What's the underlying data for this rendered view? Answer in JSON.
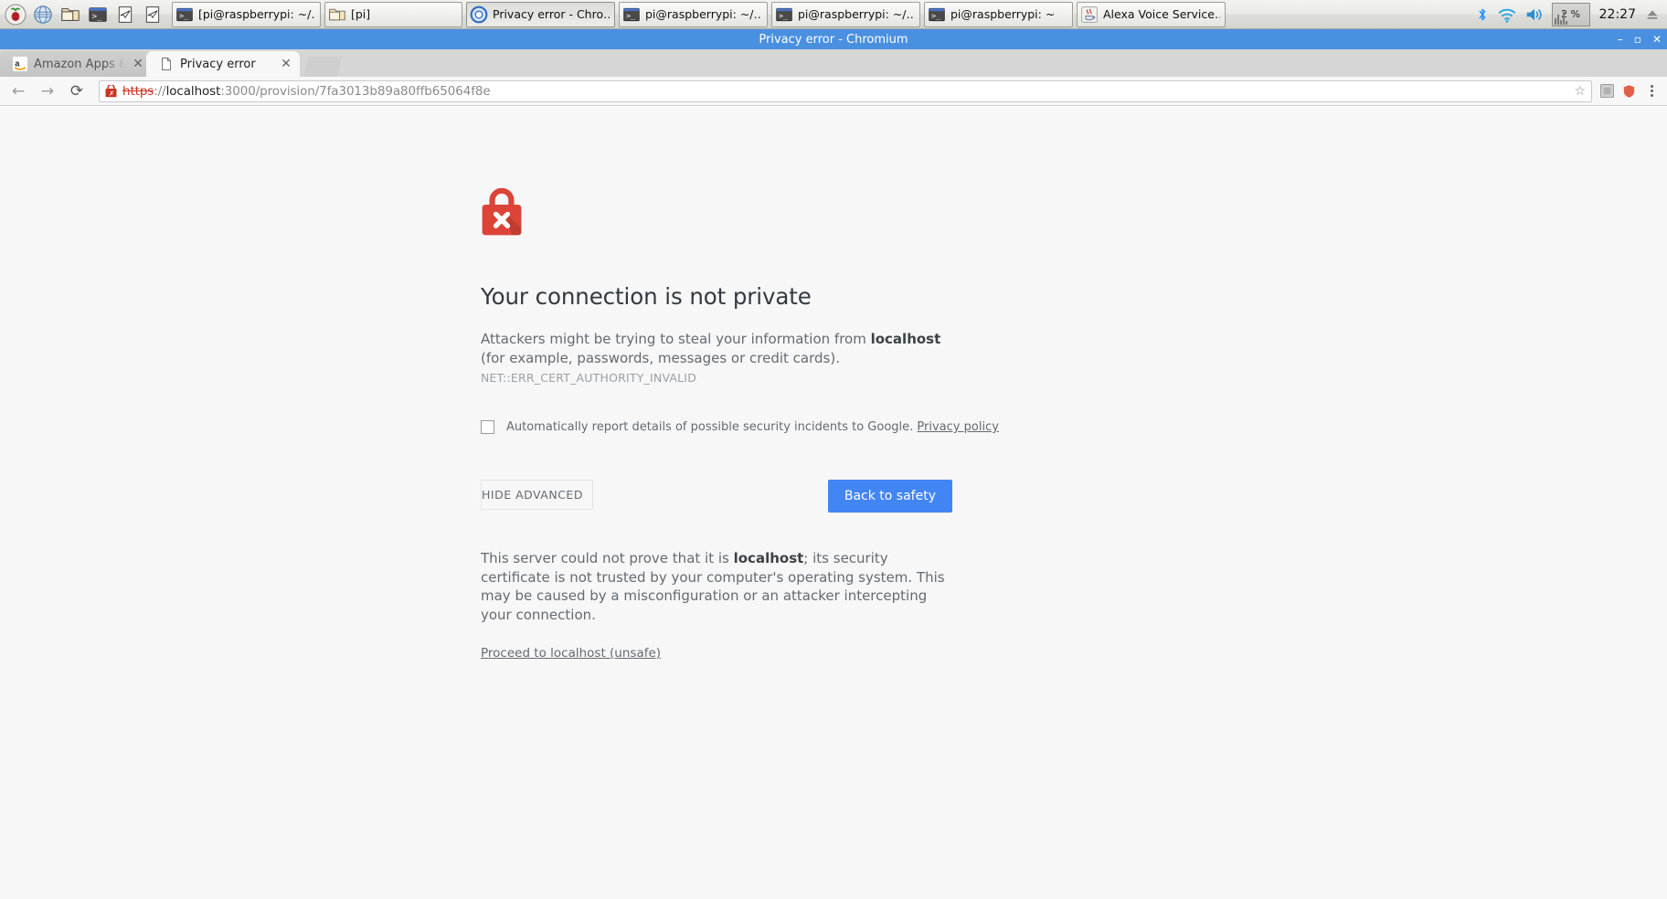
{
  "taskbar": {
    "launchers": [
      "raspberry-menu",
      "web-browser",
      "file-manager",
      "terminal",
      "mail-1",
      "mail-2"
    ],
    "windows": [
      {
        "icon": "terminal-icon",
        "label": "[pi@raspberrypi: ~/…",
        "active": false
      },
      {
        "icon": "folder-icon",
        "label": "[pi]",
        "active": false
      },
      {
        "icon": "chromium-icon",
        "label": "Privacy error - Chro…",
        "active": true
      },
      {
        "icon": "terminal-icon",
        "label": "pi@raspberrypi: ~/…",
        "active": false
      },
      {
        "icon": "terminal-icon",
        "label": "pi@raspberrypi: ~/…",
        "active": false
      },
      {
        "icon": "terminal-icon",
        "label": "pi@raspberrypi: ~",
        "active": false
      },
      {
        "icon": "java-icon",
        "label": "Alexa Voice Service…",
        "active": false
      }
    ],
    "tray": {
      "bluetooth": "bluetooth-icon",
      "wifi": "wifi-icon",
      "volume": "volume-icon",
      "cpu_label": "2 %",
      "clock": "22:27",
      "eject": "eject-icon"
    }
  },
  "window": {
    "title": "Privacy error - Chromium",
    "minimize": "–",
    "maximize": "▫",
    "close": "✕"
  },
  "tabs": [
    {
      "title": "Amazon Apps & Se",
      "favicon": "amazon-icon",
      "close": "✕",
      "active": false
    },
    {
      "title": "Privacy error",
      "favicon": "page-icon",
      "close": "✕",
      "active": true
    }
  ],
  "toolbar": {
    "back": "←",
    "forward": "→",
    "reload": "⟳",
    "url_scheme": "https",
    "url_sep": "://",
    "url_host": "localhost",
    "url_path": ":3000/provision/7fa3013b89a80ffb65064f8e",
    "bookmark_star": "☆",
    "extension_1": "extension-icon",
    "extension_2": "shield-extension-icon",
    "menu": "kebab-menu-icon"
  },
  "interstitial": {
    "icon": "broken-padlock-icon",
    "heading": "Your connection is not private",
    "body_prefix": "Attackers might be trying to steal your information from ",
    "body_host": "localhost",
    "body_suffix": " (for example, passwords, messages or credit cards). ",
    "error_code": "NET::ERR_CERT_AUTHORITY_INVALID",
    "optin_text": "Automatically report details of possible security incidents to Google. ",
    "optin_link": "Privacy policy",
    "optin_checked": false,
    "hide_advanced_label": "HIDE ADVANCED",
    "back_to_safety_label": "Back to safety",
    "advanced_prefix": "This server could not prove that it is ",
    "advanced_host": "localhost",
    "advanced_suffix": "; its security certificate is not trusted by your computer's operating system. This may be caused by a misconfiguration or an attacker intercepting your connection.",
    "proceed_link": "Proceed to localhost (unsafe)",
    "accent_button_color": "#4285f4",
    "error_icon_color": "#db4437"
  }
}
